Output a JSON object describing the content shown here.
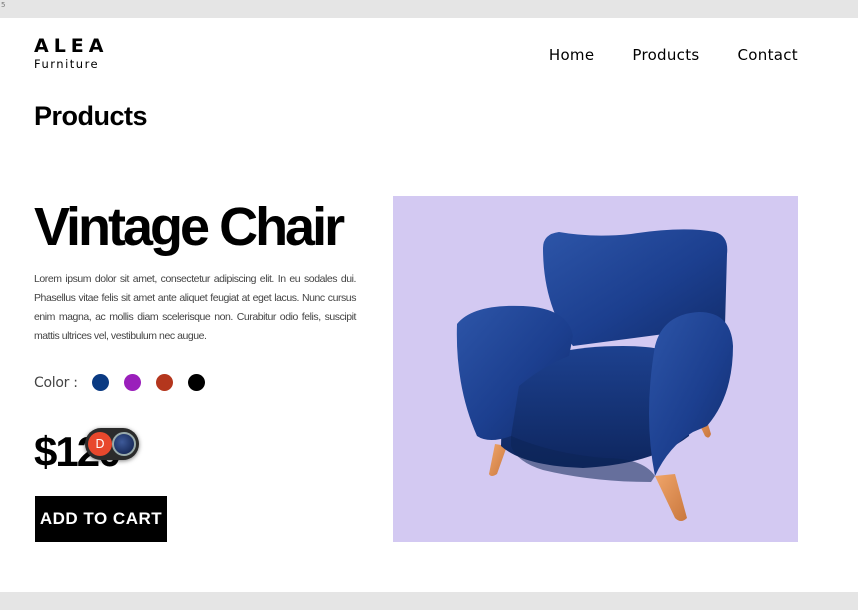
{
  "window": {
    "corner_text": "5"
  },
  "header": {
    "brand": "ALEA",
    "brand_sub": "Furniture",
    "nav": [
      {
        "label": "Home"
      },
      {
        "label": "Products"
      },
      {
        "label": "Contact"
      }
    ]
  },
  "page": {
    "title": "Products"
  },
  "product": {
    "name": "Vintage Chair",
    "description": "Lorem ipsum dolor sit amet, consectetur adipiscing elit. In eu sodales dui. Phasellus vitae felis sit amet ante aliquet feugiat at eget lacus. Nunc cursus enim magna, ac mollis diam scelerisque non. Curabitur odio felis, suscipit mattis ultrices vel, vestibulum nec augue.",
    "color_label": "Color :",
    "colors": [
      "#0a3a82",
      "#9a1fbb",
      "#b4361d",
      "#000000"
    ],
    "price": "$120",
    "add_to_cart_label": "ADD TO CART",
    "image_background": "#d3c9f2"
  },
  "overlay_badge": {
    "initial": "D",
    "color": "#e8482d"
  }
}
